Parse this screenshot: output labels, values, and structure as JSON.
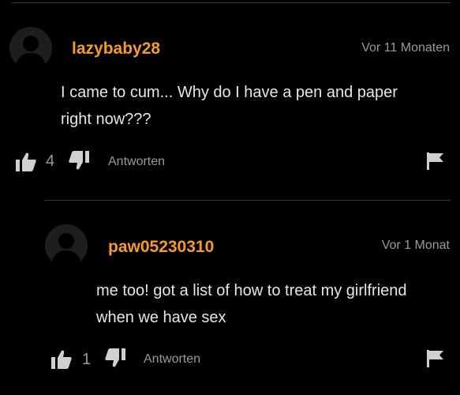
{
  "comments": [
    {
      "username": "lazybaby28",
      "timestamp": "Vor 11 Monaten",
      "text_line1": "I came to cum... Why do I have a pen and paper",
      "text_line2": "right now???",
      "like_count": "4",
      "reply_label": "Antworten",
      "avatar_icon": "user-silhouette-icon",
      "like_icon": "thumbs-up-icon",
      "dislike_icon": "thumbs-down-icon",
      "flag_icon": "flag-icon"
    },
    {
      "username": "paw05230310",
      "timestamp": "Vor 1 Monat",
      "text_line1": "me too! got a list of how to treat my girlfriend",
      "text_line2": "when we have sex",
      "like_count": "1",
      "reply_label": "Antworten",
      "avatar_icon": "user-silhouette-icon",
      "like_icon": "thumbs-up-icon",
      "dislike_icon": "thumbs-down-icon",
      "flag_icon": "flag-icon"
    }
  ],
  "colors": {
    "background": "#000000",
    "username": "#f39c2b",
    "text": "#e6e6e6",
    "muted": "#9a9a9a",
    "icon": "#d0d0d0",
    "divider": "#3a3a3a",
    "avatar_bg": "#1e1e1e"
  }
}
